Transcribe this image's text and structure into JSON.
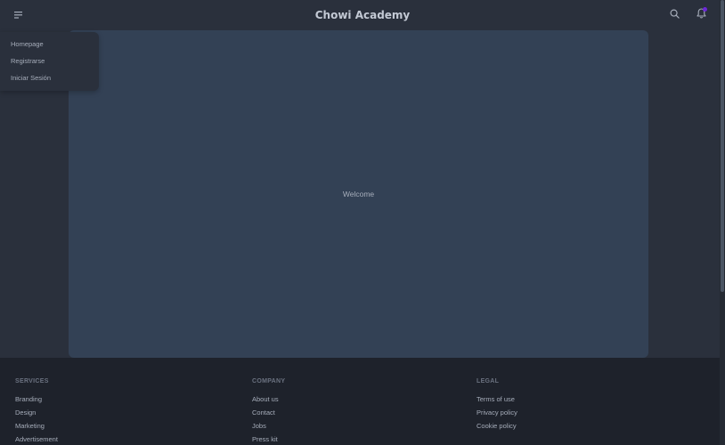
{
  "navbar": {
    "brand": "Chowi Academy",
    "menu_icon": "menu-icon",
    "search_icon": "search-icon",
    "notification_icon": "bell-icon",
    "notification_badge_color": "#6d28d9"
  },
  "dropdown": {
    "items": [
      {
        "label": "Homepage"
      },
      {
        "label": "Registrarse"
      },
      {
        "label": "Iniciar Sesión"
      }
    ]
  },
  "hero": {
    "text": "Welcome",
    "background": "#334155"
  },
  "footer": {
    "columns": [
      {
        "title": "SERVICES",
        "links": [
          "Branding",
          "Design",
          "Marketing",
          "Advertisement"
        ]
      },
      {
        "title": "COMPANY",
        "links": [
          "About us",
          "Contact",
          "Jobs",
          "Press kit"
        ]
      },
      {
        "title": "LEGAL",
        "links": [
          "Terms of use",
          "Privacy policy",
          "Cookie policy"
        ]
      }
    ]
  }
}
